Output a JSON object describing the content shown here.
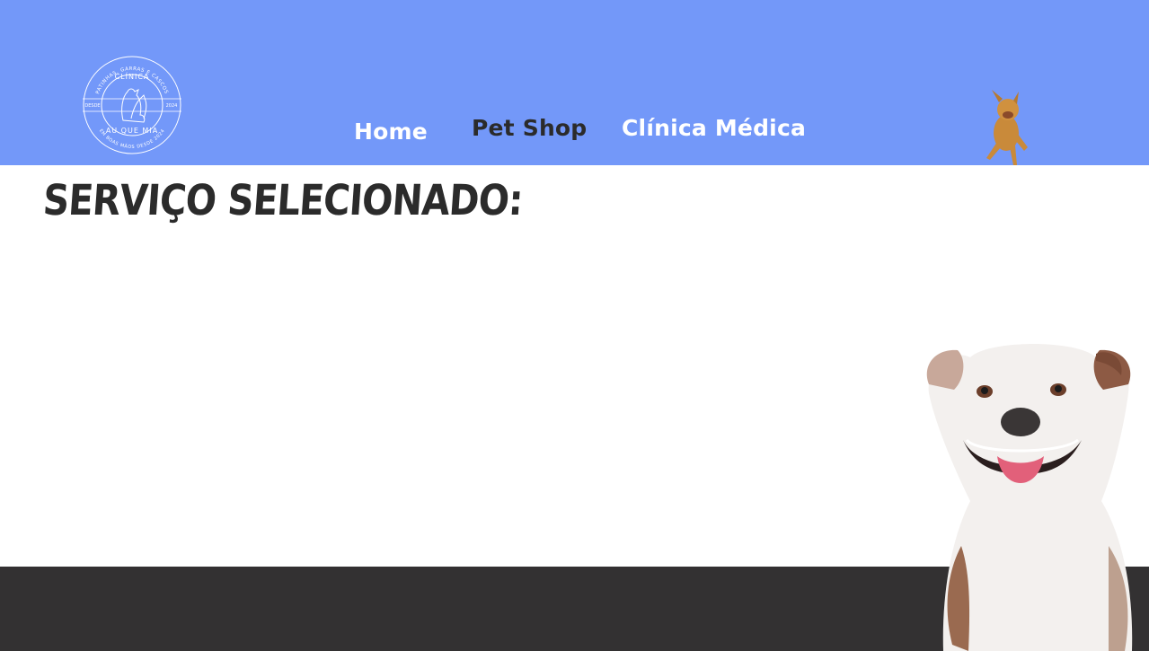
{
  "colors": {
    "header_bg": "#7398f9",
    "footer_bg": "#333132",
    "nav_active": "#2b2b2b",
    "nav_default": "#ffffff",
    "title": "#2b2b2b"
  },
  "logo": {
    "icon": "clinic-logo-icon",
    "top_text": "PATINHAS, GARRAS E CASCOS",
    "center_text": "CLÍNICA",
    "left_text": "DESDE",
    "right_text": "2024",
    "bottom_text": "AU QUE MIA",
    "bottom_arc_text": "EM BOAS MÃOS DESDE 2024"
  },
  "nav": {
    "items": [
      {
        "label": "Home"
      },
      {
        "label": "Pet Shop"
      },
      {
        "label": "Clínica Médica"
      }
    ]
  },
  "main": {
    "title": "SERVIÇO SELECIONADO:"
  },
  "images": {
    "small_dog": "running-dog-image",
    "big_dog": "smiling-dog-image"
  }
}
